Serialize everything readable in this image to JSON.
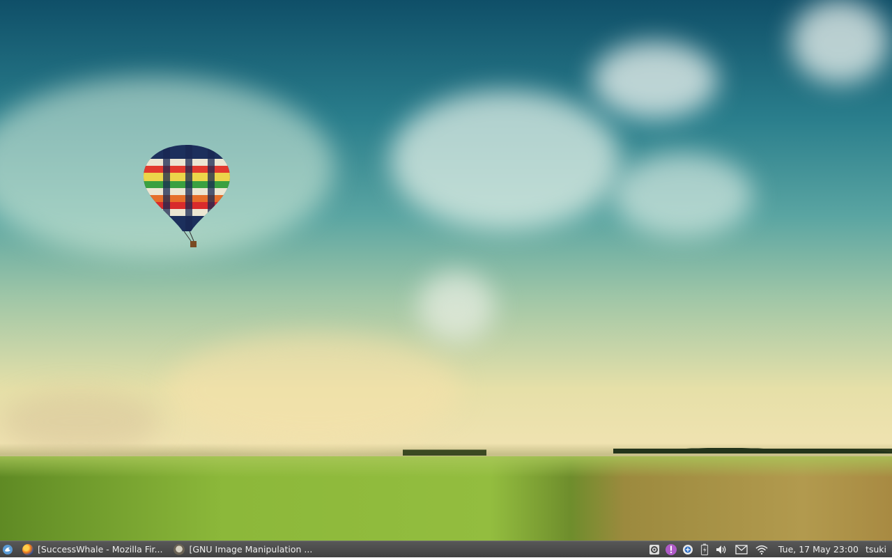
{
  "taskbar": {
    "tasks": [
      {
        "label": "[SuccessWhale - Mozilla Fir...",
        "icon": "firefox-icon"
      },
      {
        "label": "[GNU Image Manipulation ...",
        "icon": "gimp-icon"
      }
    ],
    "tray_icons": [
      "gear-icon",
      "notification-icon",
      "network-manager-icon",
      "battery-icon",
      "volume-icon",
      "mail-icon",
      "wifi-icon"
    ],
    "clock": "Tue, 17 May  23:00",
    "user": "tsuki"
  },
  "colors": {
    "taskbar_bg": "#4a4a4a",
    "taskbar_text": "#eeeeee"
  }
}
